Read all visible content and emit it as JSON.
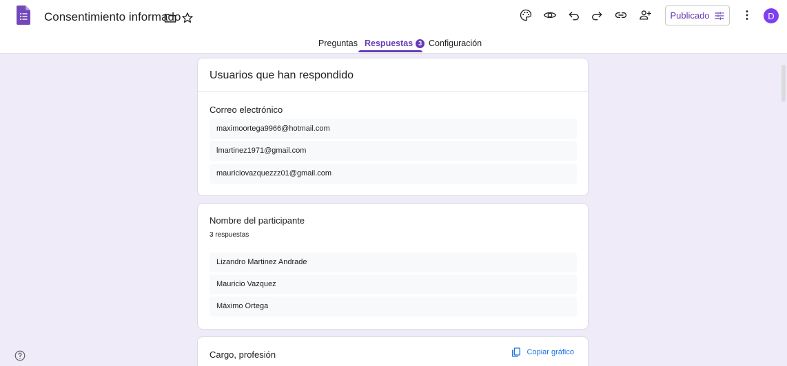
{
  "header": {
    "title": "Consentimiento informado",
    "publish_label": "Publicado",
    "avatar_initial": "D"
  },
  "tabs": [
    {
      "label": "Preguntas"
    },
    {
      "label": "Respuestas",
      "badge": "3"
    },
    {
      "label": "Configuración"
    }
  ],
  "colors": {
    "accent": "#673ab7",
    "background": "#f0ebf8",
    "link": "#1a73e8"
  },
  "cards": {
    "respondents": {
      "title": "Usuarios que han respondido",
      "question": "Correo electrónico",
      "responses": [
        "maximoortega9966@hotmail.com",
        "lmartinez1971@gmail.com",
        "mauriciovazquezzz01@gmail.com"
      ]
    },
    "participant_name": {
      "question": "Nombre del participante",
      "count": "3 respuestas",
      "responses": [
        "Lizandro Martinez Andrade",
        "Mauricio Vazquez",
        "Máximo Ortega"
      ]
    },
    "position": {
      "question": "Cargo, profesión",
      "copy_label": "Copiar gráfico"
    }
  }
}
